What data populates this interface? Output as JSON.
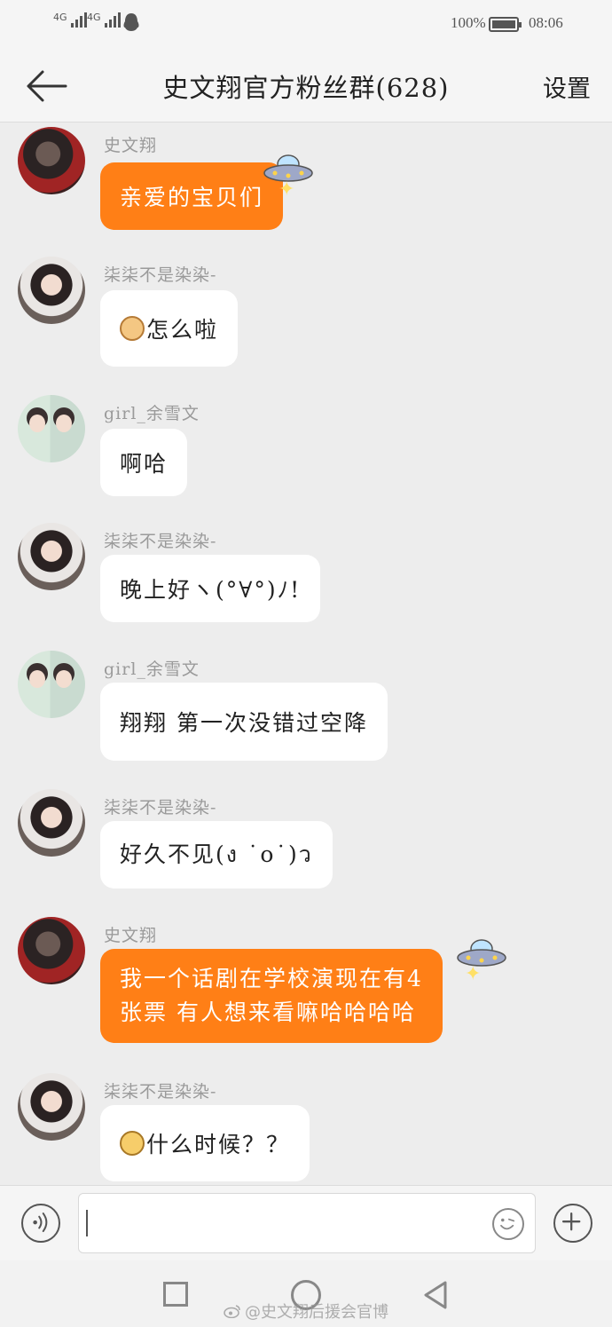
{
  "status_bar": {
    "network_1": "4G",
    "network_2": "4G",
    "battery": "100%",
    "time": "08:06"
  },
  "header": {
    "title": "史文翔官方粉丝群(628)",
    "settings_label": "设置"
  },
  "messages": [
    {
      "sender": "史文翔",
      "text": "亲爱的宝贝们",
      "avatar": "avatar-dark"
    },
    {
      "sender": "柒柒不是染染-",
      "text": "怎么啦",
      "avatar": "avatar-girl"
    },
    {
      "sender": "girl_余雪文",
      "text": "啊哈",
      "avatar": "avatar-kids"
    },
    {
      "sender": "柒柒不是染染-",
      "text": "晚上好ヽ(°∀°)ﾉ!",
      "avatar": "avatar-girl"
    },
    {
      "sender": "girl_余雪文",
      "text": "翔翔 第一次没错过空降",
      "avatar": "avatar-kids"
    },
    {
      "sender": "柒柒不是染染-",
      "text": "好久不见(ง ˙o˙)ว",
      "avatar": "avatar-girl"
    },
    {
      "sender": "史文翔",
      "line1": "我一个话剧在学校演现在有4",
      "line2": "张票 有人想来看嘛哈哈哈哈",
      "avatar": "avatar-dark"
    },
    {
      "sender": "柒柒不是染染-",
      "text": "什么时候？？",
      "avatar": "avatar-girl"
    }
  ],
  "input_bar": {
    "voice_icon": "voice-icon",
    "emoji_icon": "smiley-icon",
    "plus_icon": "plus-icon",
    "placeholder": ""
  },
  "watermark": "@史文翔后援会官博",
  "colors": {
    "accent_bubble": "#ff7f16",
    "background": "#ededed"
  }
}
